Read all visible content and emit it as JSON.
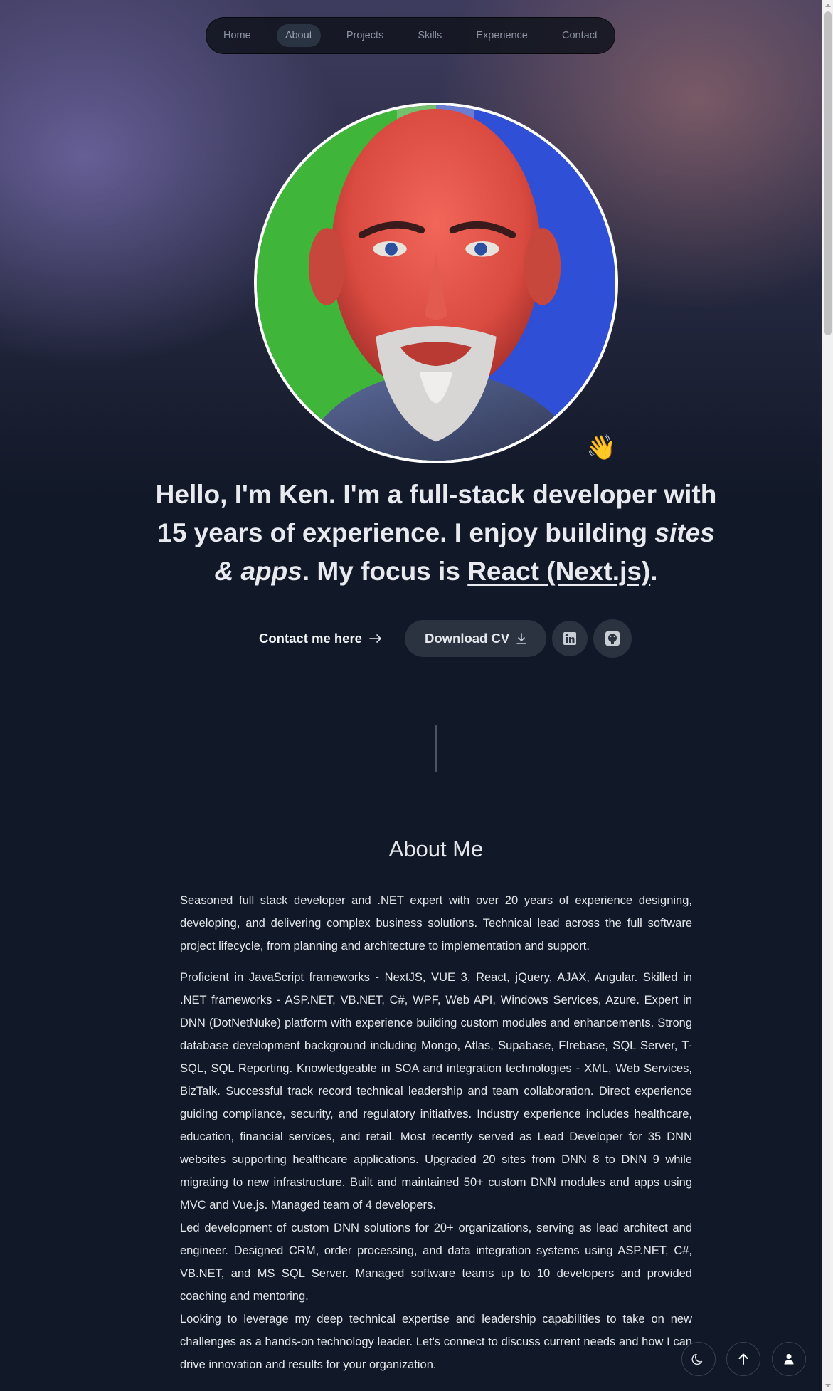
{
  "nav": {
    "items": [
      {
        "label": "Home"
      },
      {
        "label": "About"
      },
      {
        "label": "Projects"
      },
      {
        "label": "Skills"
      },
      {
        "label": "Experience"
      },
      {
        "label": "Contact"
      }
    ],
    "active": "About"
  },
  "hero": {
    "avatar_icon": "avatar-portrait",
    "wave_emoji": "👋",
    "intro": {
      "hello": "Hello, I'm Ken.",
      "im_a": " I'm a ",
      "role": "full-stack developer",
      "with": " with ",
      "years": "15 years",
      "of_exp": " of experience. I enjoy building ",
      "sites": "sites & apps",
      "focus": ". My focus is ",
      "tech": "React (Next.js)",
      "end": "."
    },
    "contact_label": "Contact me here",
    "download_label": "Download CV",
    "linkedin_icon": "linkedin-icon",
    "github_icon": "github-icon"
  },
  "about": {
    "title": "About Me",
    "paragraphs": [
      "Seasoned full stack developer and .NET expert with over 20 years of experience designing, developing, and delivering complex business solutions. Technical lead across the full software project lifecycle, from planning and architecture to implementation and support.",
      "Proficient in JavaScript frameworks - NextJS, VUE 3, React, jQuery, AJAX, Angular. Skilled in .NET frameworks - ASP.NET, VB.NET, C#, WPF, Web API, Windows Services, Azure. Expert in DNN (DotNetNuke) platform with experience building custom modules and enhancements. Strong database development background including Mongo, Atlas, Supabase, FIrebase, SQL Server, T-SQL, SQL Reporting. Knowledgeable in SOA and integration technologies - XML, Web Services, BizTalk. Successful track record technical leadership and team collaboration. Direct experience guiding compliance, security, and regulatory initiatives. Industry experience includes healthcare, education, financial services, and retail. Most recently served as Lead Developer for 35 DNN websites supporting healthcare applications. Upgraded 20 sites from DNN 8 to DNN 9 while migrating to new infrastructure. Built and maintained 50+ custom DNN modules and apps using MVC and Vue.js. Managed team of 4 developers.",
      "Led development of custom DNN solutions for 20+ organizations, serving as lead architect and engineer. Designed CRM, order processing, and data integration systems using ASP.NET, C#, VB.NET, and MS SQL Server. Managed software teams up to 10 developers and provided coaching and mentoring.",
      "Looking to leverage my deep technical expertise and leadership capabilities to take on new challenges as a hands-on technology leader. Let's connect to discuss current needs and how I can drive innovation and results for your organization."
    ]
  },
  "floating": {
    "theme_icon": "moon-icon",
    "top_icon": "arrow-up-icon",
    "user_icon": "user-icon"
  }
}
